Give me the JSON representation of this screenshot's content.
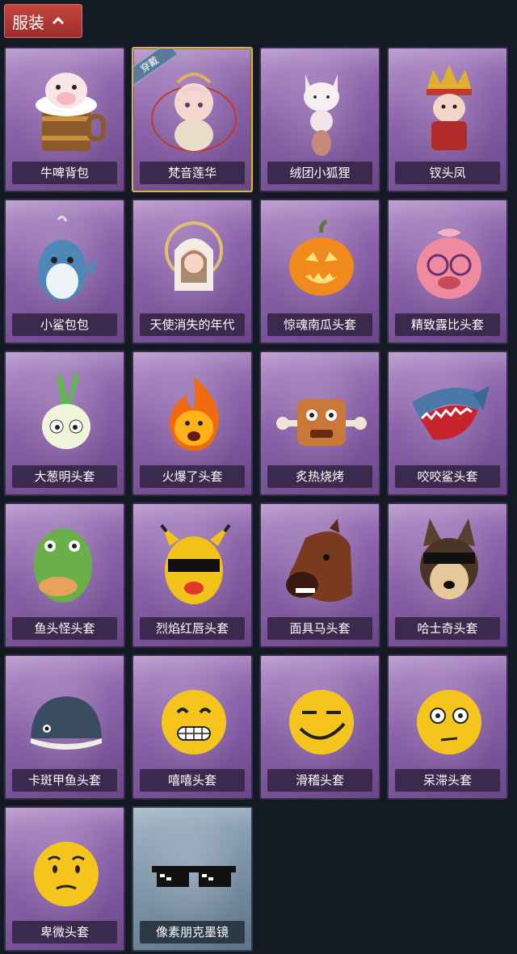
{
  "header": {
    "title": "服装",
    "icon": "chevron-up-icon"
  },
  "items": [
    {
      "name": "牛啤背包",
      "icon": "cow-beer-backpack-icon"
    },
    {
      "name": "梵音莲华",
      "icon": "lotus-character-icon",
      "badge": "穿戴"
    },
    {
      "name": "绒团小狐狸",
      "icon": "fluffy-fox-icon"
    },
    {
      "name": "钗头凤",
      "icon": "phoenix-headdress-icon"
    },
    {
      "name": "小鲨包包",
      "icon": "shark-bag-icon"
    },
    {
      "name": "天使消失的年代",
      "icon": "angel-doll-icon"
    },
    {
      "name": "惊魂南瓜头套",
      "icon": "pumpkin-head-icon"
    },
    {
      "name": "精致露比头套",
      "icon": "loopy-head-icon"
    },
    {
      "name": "大葱明头套",
      "icon": "scallion-head-icon"
    },
    {
      "name": "火爆了头套",
      "icon": "fire-head-icon"
    },
    {
      "name": "炙热烧烤",
      "icon": "meat-head-icon"
    },
    {
      "name": "咬咬鲨头套",
      "icon": "shark-head-icon"
    },
    {
      "name": "鱼头怪头套",
      "icon": "fish-head-icon"
    },
    {
      "name": "烈焰红唇头套",
      "icon": "yellow-mask-icon"
    },
    {
      "name": "面具马头套",
      "icon": "horse-head-icon"
    },
    {
      "name": "哈士奇头套",
      "icon": "husky-head-icon"
    },
    {
      "name": "卡斑甲鱼头套",
      "icon": "fish-dome-icon"
    },
    {
      "name": "嘻嘻头套",
      "icon": "grin-emoji-icon"
    },
    {
      "name": "滑稽头套",
      "icon": "smirk-emoji-icon"
    },
    {
      "name": "呆滞头套",
      "icon": "stare-emoji-icon"
    },
    {
      "name": "卑微头套",
      "icon": "humble-emoji-icon"
    },
    {
      "name": "像素朋克墨镜",
      "icon": "pixel-sunglasses-icon"
    }
  ]
}
